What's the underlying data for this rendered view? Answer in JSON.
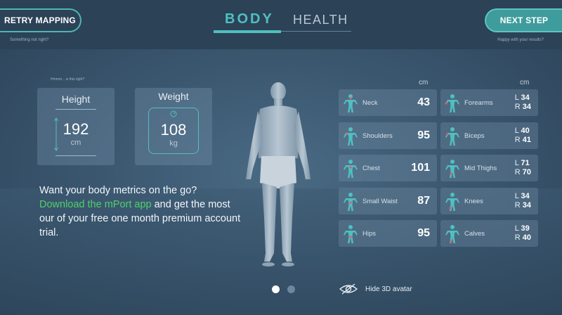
{
  "header": {
    "retry_label": "RETRY MAPPING",
    "retry_hint": "Something not right?",
    "next_label": "NEXT STEP",
    "next_hint": "Happy with your results?",
    "tabs": [
      {
        "label": "BODY",
        "active": true
      },
      {
        "label": "HEALTH",
        "active": false
      }
    ]
  },
  "left": {
    "hint": "Hmmm... is this right?",
    "height": {
      "title": "Height",
      "value": "192",
      "unit": "cm"
    },
    "weight": {
      "title": "Weight",
      "value": "108",
      "unit": "kg"
    }
  },
  "promo": {
    "line1": "Want your body metrics on the go?",
    "link": "Download the mPort app",
    "rest": " and get the most our of your free one month premium account trial."
  },
  "measurements": {
    "unit_left": "cm",
    "unit_right": "cm",
    "left_column": [
      {
        "label": "Neck",
        "value": "43"
      },
      {
        "label": "Shoulders",
        "value": "95"
      },
      {
        "label": "Chest",
        "value": "101"
      },
      {
        "label": "Small Waist",
        "value": "87"
      },
      {
        "label": "Hips",
        "value": "95"
      }
    ],
    "right_column": [
      {
        "label": "Forearms",
        "l": "34",
        "r": "34"
      },
      {
        "label": "Biceps",
        "l": "40",
        "r": "41"
      },
      {
        "label": "Mid Thighs",
        "l": "71",
        "r": "70"
      },
      {
        "label": "Knees",
        "l": "34",
        "r": "34"
      },
      {
        "label": "Calves",
        "l": "39",
        "r": "40"
      }
    ],
    "l_prefix": "L",
    "r_prefix": "R"
  },
  "footer": {
    "hide_avatar_label": "Hide 3D avatar",
    "page_dots": 2,
    "active_dot": 1
  },
  "colors": {
    "accent": "#4fc0c0",
    "link": "#4fd06a",
    "marker": "#e05a6a"
  }
}
